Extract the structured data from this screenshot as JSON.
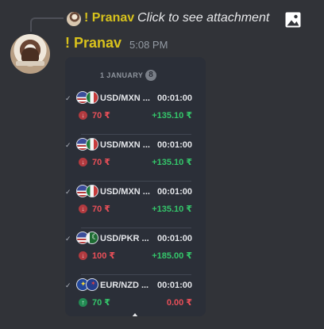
{
  "reply": {
    "username": "! Pranav",
    "text": "Click to see attachment",
    "icon": "image-icon"
  },
  "message": {
    "username": "! Pranav",
    "timestamp": "5:08 PM"
  },
  "card": {
    "date_label": "1 JANUARY",
    "count_badge": "8",
    "trades": [
      {
        "pair": "USD/MXN ...",
        "time": "00:01:00",
        "direction": "down",
        "amount": "70 ₹",
        "profit": "+135.10 ₹",
        "flags": [
          "us-flag-icon",
          "mexico-flag-icon"
        ]
      },
      {
        "pair": "USD/MXN ...",
        "time": "00:01:00",
        "direction": "down",
        "amount": "70 ₹",
        "profit": "+135.10 ₹",
        "flags": [
          "us-flag-icon",
          "mexico-flag-icon"
        ]
      },
      {
        "pair": "USD/MXN ...",
        "time": "00:01:00",
        "direction": "down",
        "amount": "70 ₹",
        "profit": "+135.10 ₹",
        "flags": [
          "us-flag-icon",
          "mexico-flag-icon"
        ]
      },
      {
        "pair": "USD/PKR ...",
        "time": "00:01:00",
        "direction": "down",
        "amount": "100 ₹",
        "profit": "+185.00 ₹",
        "flags": [
          "us-flag-icon",
          "pakistan-flag-icon"
        ]
      },
      {
        "pair": "EUR/NZD ...",
        "time": "00:01:00",
        "direction": "up",
        "amount": "70 ₹",
        "profit": "0.00 ₹",
        "flags": [
          "eu-flag-icon",
          "new-zealand-flag-icon"
        ]
      }
    ]
  },
  "colors": {
    "background": "#313338",
    "username": "#d9c21c",
    "card": "#2b2f38",
    "profit_positive": "#34c56a",
    "loss": "#e84f58"
  }
}
